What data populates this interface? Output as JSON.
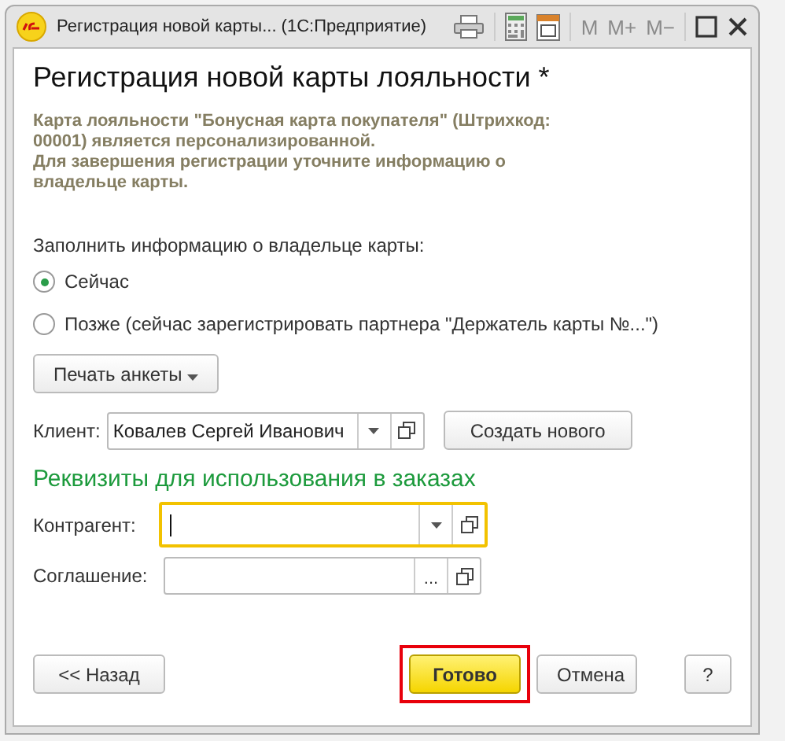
{
  "window": {
    "title": "Регистрация новой карты...  (1С:Предприятие)",
    "memory_buttons": [
      {
        "label": "M",
        "disabled": true
      },
      {
        "label": "M+",
        "disabled": true
      },
      {
        "label": "M−",
        "disabled": true
      }
    ]
  },
  "heading": "Регистрация новой карты лояльности *",
  "info": "Карта лояльности \"Бонусная карта покупателя\" (Штрихкод: 00001) является персонализированной.\nДля завершения регистрации уточните информацию о владельце карты.",
  "fill_label": "Заполнить информацию о владельце карты:",
  "options": [
    {
      "label": "Сейчас",
      "selected": true
    },
    {
      "label": "Позже (сейчас зарегистрировать партнера \"Держатель карты №...\")",
      "selected": false
    }
  ],
  "print_button": "Печать анкеты",
  "client": {
    "label": "Клиент:",
    "value": "Ковалев Сергей Иванович",
    "create_button": "Создать нового"
  },
  "section_title": "Реквизиты для использования в заказах",
  "fields": [
    {
      "label": "Контрагент:",
      "kind": "dropdown",
      "focused": true
    },
    {
      "label": "Соглашение:",
      "kind": "choice",
      "focused": false,
      "choice_text": "..."
    }
  ],
  "footer": {
    "back": "<< Назад",
    "done": {
      "label": "Готово",
      "highlighted": true
    },
    "cancel": "Отмена",
    "help": "?"
  }
}
